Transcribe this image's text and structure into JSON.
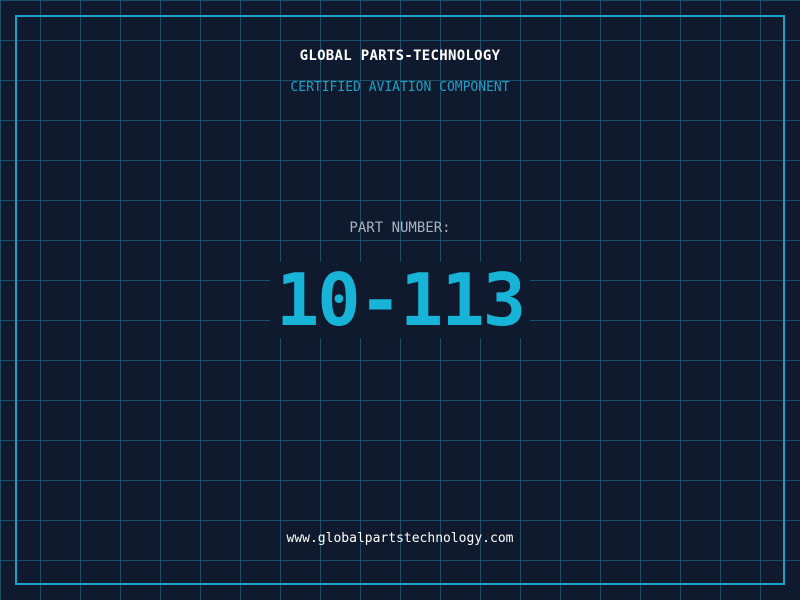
{
  "header": {
    "company_name": "GLOBAL PARTS-TECHNOLOGY",
    "subtitle": "CERTIFIED AVIATION COMPONENT"
  },
  "part": {
    "label": "PART NUMBER:",
    "number": "10-113"
  },
  "footer": {
    "website": "www.globalpartstechnology.com"
  },
  "colors": {
    "background": "#0f1a2e",
    "grid_line": "#287896",
    "accent": "#1da0c8",
    "part_number": "#18b4d8",
    "label_gray": "#a8b4c4",
    "text_white": "#ffffff"
  }
}
